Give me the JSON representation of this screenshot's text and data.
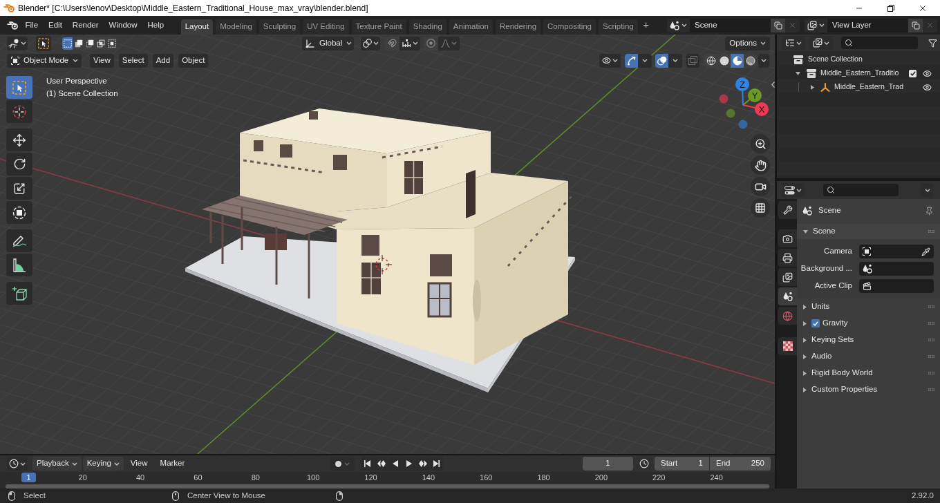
{
  "window": {
    "title": "Blender* [C:\\Users\\lenov\\Desktop\\Middle_Eastern_Traditional_House_max_vray\\blender.blend]"
  },
  "top_bar": {
    "menus": [
      "File",
      "Edit",
      "Render",
      "Window",
      "Help"
    ],
    "workspaces": [
      {
        "label": "Layout",
        "selected": true
      },
      {
        "label": "Modeling",
        "selected": false
      },
      {
        "label": "Sculpting",
        "selected": false
      },
      {
        "label": "UV Editing",
        "selected": false
      },
      {
        "label": "Texture Paint",
        "selected": false
      },
      {
        "label": "Shading",
        "selected": false
      },
      {
        "label": "Animation",
        "selected": false
      },
      {
        "label": "Rendering",
        "selected": false
      },
      {
        "label": "Compositing",
        "selected": false
      },
      {
        "label": "Scripting",
        "selected": false
      }
    ],
    "add_workspace": "+",
    "scene": "Scene",
    "view_layer": "View Layer"
  },
  "tool_header": {
    "select_modes": [
      {
        "kind": "set",
        "selected": true
      },
      {
        "kind": "extend",
        "selected": false
      },
      {
        "kind": "subtract",
        "selected": false
      },
      {
        "kind": "difference",
        "selected": false
      },
      {
        "kind": "intersect",
        "selected": false
      }
    ],
    "orientation": "Global",
    "options": "Options"
  },
  "viewport_header": {
    "mode": "Object Mode",
    "menus": [
      "View",
      "Select",
      "Add",
      "Object"
    ],
    "toggles": [
      {
        "kind": "gizmos",
        "on": true
      },
      {
        "kind": "overlays",
        "on": true
      },
      {
        "kind": "xray",
        "on": false
      }
    ],
    "shading": [
      {
        "kind": "wireframe",
        "selected": false
      },
      {
        "kind": "solid",
        "selected": false
      },
      {
        "kind": "material",
        "selected": true
      },
      {
        "kind": "rendered",
        "selected": false
      }
    ]
  },
  "viewport": {
    "view_name": "User Perspective",
    "collection": "(1) Scene Collection",
    "tool_groups": [
      [
        {
          "kind": "select_box",
          "selected": true
        },
        {
          "kind": "cursor",
          "selected": false
        }
      ],
      [
        {
          "kind": "move",
          "selected": false
        },
        {
          "kind": "rotate",
          "selected": false
        },
        {
          "kind": "scale",
          "selected": false
        },
        {
          "kind": "transform",
          "selected": false
        }
      ],
      [
        {
          "kind": "annotate",
          "selected": false
        },
        {
          "kind": "measure",
          "selected": false
        }
      ],
      [
        {
          "kind": "add_cube",
          "selected": false
        }
      ]
    ],
    "axes": [
      {
        "label": "Z",
        "color": "#2f83e3"
      },
      {
        "label": "Y",
        "color": "#6b9b23"
      },
      {
        "label": "X",
        "color": "#f03a54"
      }
    ]
  },
  "timeline": {
    "menus": [
      {
        "label": "Playback",
        "kind": "dropdown"
      },
      {
        "label": "Keying",
        "kind": "dropdown"
      },
      {
        "label": "View",
        "kind": "menu"
      },
      {
        "label": "Marker",
        "kind": "menu"
      }
    ],
    "current_frame": "1",
    "start": {
      "label": "Start",
      "value": "1"
    },
    "end": {
      "label": "End",
      "value": "250"
    },
    "playhead": "1",
    "ruler": [
      "20",
      "40",
      "60",
      "80",
      "100",
      "120",
      "140",
      "160",
      "180",
      "200",
      "220",
      "240"
    ]
  },
  "outliner": {
    "root": "Scene Collection",
    "items": [
      {
        "label": "Middle_Eastern_Traditio",
        "kind": "collection",
        "expanded": true,
        "checked": true,
        "children": [
          {
            "label": "Middle_Eastern_Trad",
            "kind": "empty",
            "expanded": false
          }
        ]
      }
    ]
  },
  "properties": {
    "tabs": [
      {
        "kind": "tool",
        "selected": false
      },
      {
        "kind": "render",
        "selected": false
      },
      {
        "kind": "output",
        "selected": false
      },
      {
        "kind": "view_layer",
        "selected": false
      },
      {
        "kind": "scene",
        "selected": true
      },
      {
        "kind": "world",
        "selected": false
      },
      {
        "kind": "texture",
        "selected": false
      }
    ],
    "context": "Scene",
    "panels": [
      {
        "label": "Scene",
        "kind": "plain",
        "expanded": true,
        "fields": [
          {
            "label": "Camera",
            "kind": "camera"
          },
          {
            "label": "Background ...",
            "kind": "scene"
          },
          {
            "label": "Active Clip",
            "kind": "clip"
          }
        ]
      },
      {
        "label": "Units",
        "kind": "plain",
        "expanded": false
      },
      {
        "label": "Gravity",
        "kind": "toggle",
        "expanded": false,
        "checked": true
      },
      {
        "label": "Keying Sets",
        "kind": "plain",
        "expanded": false
      },
      {
        "label": "Audio",
        "kind": "plain",
        "expanded": false
      },
      {
        "label": "Rigid Body World",
        "kind": "plain",
        "expanded": false
      },
      {
        "label": "Custom Properties",
        "kind": "plain",
        "expanded": false
      }
    ]
  },
  "status_bar": {
    "hints": [
      {
        "kind": "left",
        "label": "Select"
      },
      {
        "kind": "middle",
        "label": "Center View to Mouse"
      },
      {
        "kind": "right"
      }
    ],
    "version": "2.92.0"
  }
}
